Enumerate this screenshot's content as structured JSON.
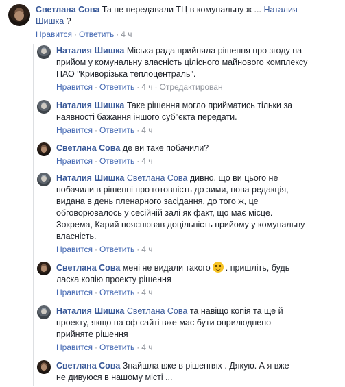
{
  "actions": {
    "like": "Нравится",
    "reply": "Ответить",
    "sep": "·",
    "edited": "Отредактирован"
  },
  "comments": [
    {
      "author": "Светлана Сова",
      "parts": [
        "Та не передавали ТЦ в комунальну ж ... ",
        "Наталия",
        "Шишка",
        " ?"
      ],
      "time": "4 ч"
    },
    {
      "author": "Наталия Шишка",
      "lines": [
        "Міська рада прийняла рішення про згоду на",
        "прийом у комунальну власність цілісного майнового комплексу",
        "ПАО \"Криворізька теплоцентраль\"."
      ],
      "time": "4 ч"
    },
    {
      "author": "Наталия Шишка",
      "lines": [
        "Таке рішення могло прийматись тільки за",
        "наявності бажання іншого суб\"єкта передати."
      ],
      "time": "4 ч"
    },
    {
      "author": "Светлана Сова",
      "lines": [
        "де ви таке побачили?"
      ],
      "time": "4 ч"
    },
    {
      "author": "Наталия Шишка",
      "mention": "Светлана Сова",
      "lines": [
        "дивно, що ви цього не",
        "побачили в рішенні про готовність до зими, нова редакція,",
        "видана в день пленарного засідання, до того ж, це",
        "обговорювалось у сесійній залі як факт, що має місце.",
        "Зокрема, Карий пояснював доцільність прийому у комунальну",
        "власність."
      ],
      "time": "4 ч"
    },
    {
      "author": "Светлана Сова",
      "lines": [
        "мені не видали такого",
        ". пришліть, будь",
        "ласка копію проекту рішення"
      ],
      "time": "4 ч"
    },
    {
      "author": "Наталия Шишка",
      "mention": "Светлана Сова",
      "lines": [
        "та навіщо копія та ще й",
        "проекту, якщо на оф сайті вже має бути оприлюднено",
        "прийняте рішення"
      ],
      "time": "4 ч"
    },
    {
      "author": "Светлана Сова",
      "lines": [
        "Знайшла вже в рішеннях . Дякую. А я вже",
        "не дивуюся в нашому місті ..."
      ]
    }
  ]
}
